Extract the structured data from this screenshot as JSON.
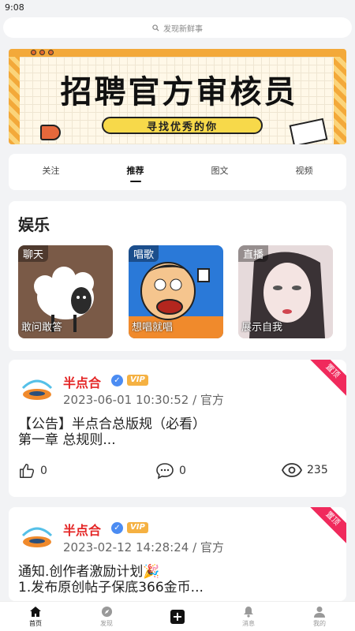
{
  "status": {
    "time": "9:08"
  },
  "search": {
    "placeholder": "发现新鲜事"
  },
  "banner": {
    "title": "招聘官方审核员",
    "subtitle": "寻找优秀的你"
  },
  "tabs": [
    {
      "label": "关注",
      "active": false
    },
    {
      "label": "推荐",
      "active": true
    },
    {
      "label": "图文",
      "active": false
    },
    {
      "label": "视频",
      "active": false
    }
  ],
  "entertainment": {
    "title": "娱乐",
    "cards": [
      {
        "tag": "聊天",
        "caption": "敢问敢答"
      },
      {
        "tag": "唱歌",
        "caption": "想唱就唱"
      },
      {
        "tag": "直播",
        "caption": "展示自我"
      }
    ]
  },
  "posts": [
    {
      "ribbon": "置顶",
      "author": "半点合",
      "verified": "✓",
      "vip": "VIP",
      "meta": "2023-06-01 10:30:52 / 官方",
      "content": "【公告】半点合总版规（必看）\n第一章 总规则...",
      "likes": "0",
      "comments": "0",
      "views": "235"
    },
    {
      "ribbon": "置顶",
      "author": "半点合",
      "verified": "✓",
      "vip": "VIP",
      "meta": "2023-02-12 14:28:24 / 官方",
      "content": "通知.创作者激励计划🎉\n1.发布原创帖子保底366金币..."
    }
  ],
  "bottom_nav": [
    {
      "label": "首页",
      "icon": "home-icon",
      "active": true
    },
    {
      "label": "发现",
      "icon": "compass-icon",
      "active": false
    },
    {
      "label": "+",
      "icon": "plus-icon",
      "active": false
    },
    {
      "label": "消息",
      "icon": "bell-icon",
      "active": false
    },
    {
      "label": "我的",
      "icon": "user-icon",
      "active": false
    }
  ],
  "colors": {
    "accent": "#e42525",
    "ribbon": "#f02a5c",
    "vip": "#f5b142",
    "verified": "#4b8cf2"
  }
}
